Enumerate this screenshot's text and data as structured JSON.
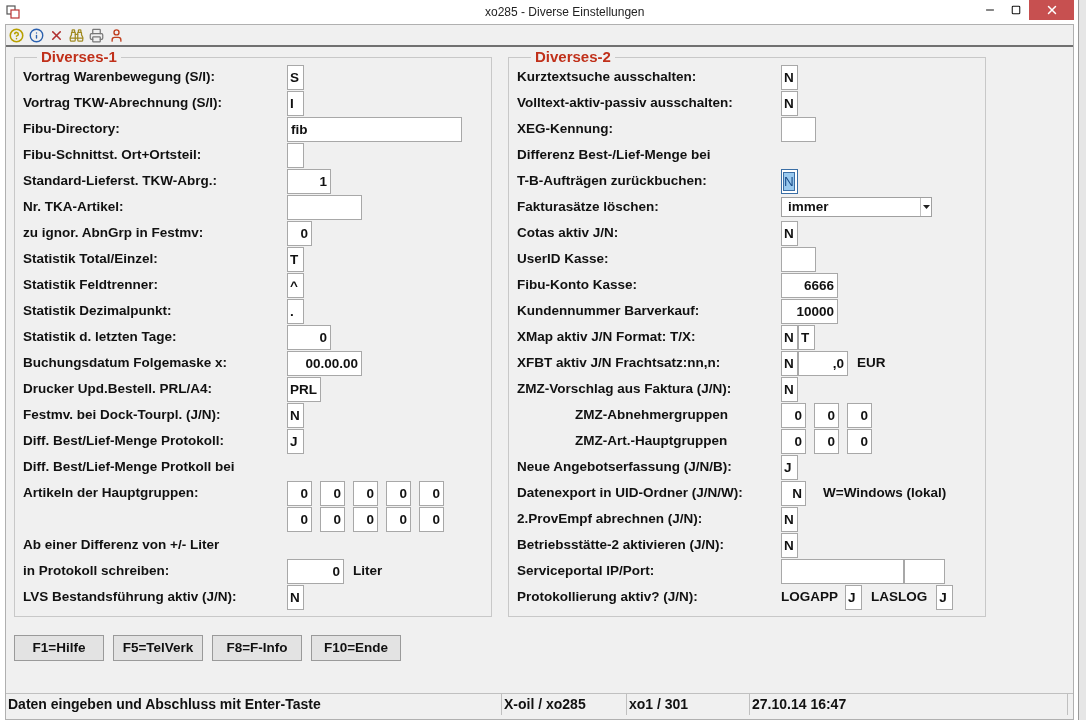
{
  "window": {
    "title": "xo285 - Diverse Einstellungen"
  },
  "panels": [
    {
      "title": "Diverses-1",
      "rows": [
        {
          "label": "Vortrag Warenbewegung  (S/I):",
          "items": [
            {
              "kind": "flag",
              "value": "S",
              "focused": false
            }
          ]
        },
        {
          "label": "Vortrag TKW-Abrechnung (S/I):",
          "items": [
            {
              "kind": "flag",
              "value": "I",
              "focused": false
            }
          ]
        },
        {
          "label": "Fibu-Directory:",
          "items": [
            {
              "kind": "long",
              "value": "fib",
              "focused": false
            }
          ]
        },
        {
          "label": "Fibu-Schnittst. Ort+Ortsteil:",
          "items": [
            {
              "kind": "flag",
              "focused": false
            }
          ]
        },
        {
          "label": "Standard-Lieferst. TKW-Abrg.:",
          "items": [
            {
              "kind": "number",
              "value": "1",
              "focused": false
            }
          ]
        },
        {
          "label": "Nr. TKA-Artikel:",
          "items": [
            {
              "kind": "wide",
              "focused": false
            }
          ]
        },
        {
          "label": "zu ignor. AbnGrp in Festmv:",
          "items": [
            {
              "kind": "digit",
              "value": "0",
              "focused": false
            }
          ]
        },
        {
          "label": "Statistik Total/Einzel:",
          "items": [
            {
              "kind": "flag",
              "value": "T",
              "focused": false
            }
          ]
        },
        {
          "label": "Statistik Feldtrenner:",
          "items": [
            {
              "kind": "flag",
              "value": "^",
              "focused": false
            }
          ]
        },
        {
          "label": "Statistik Dezimalpunkt:",
          "items": [
            {
              "kind": "flag",
              "value": ".",
              "focused": false
            }
          ]
        },
        {
          "label": "Statistik d. letzten Tage:",
          "items": [
            {
              "kind": "number",
              "value": "0",
              "focused": false
            }
          ]
        },
        {
          "label": "Buchungsdatum Folgemaske x:",
          "items": [
            {
              "kind": "wide",
              "value": "00.00.00",
              "focused": false
            }
          ]
        },
        {
          "label": "Drucker Upd.Bestell. PRL/A4:",
          "items": [
            {
              "kind": "short",
              "value": "PRL",
              "focused": false
            }
          ]
        },
        {
          "label": "Festmv. bei Dock-Tourpl. (J/N):",
          "items": [
            {
              "kind": "flag",
              "value": "N",
              "focused": false
            }
          ]
        },
        {
          "label": "Diff. Best/Lief-Menge Protokoll:",
          "items": [
            {
              "kind": "flag",
              "value": "J",
              "focused": false
            }
          ]
        },
        {
          "label": "Diff. Best/Lief-Menge Protkoll bei",
          "items": []
        },
        {
          "label": "Artikeln der Hauptgruppen:",
          "items": [
            {
              "kind": "digit",
              "value": "0",
              "focused": false
            },
            {
              "kind": "digit",
              "value": "0",
              "focused": false
            },
            {
              "kind": "digit",
              "value": "0",
              "focused": false
            },
            {
              "kind": "digit",
              "value": "0",
              "focused": false
            },
            {
              "kind": "digit",
              "value": "0",
              "focused": false
            }
          ]
        },
        {
          "items": [
            {
              "kind": "digit",
              "value": "0",
              "focused": false
            },
            {
              "kind": "digit",
              "value": "0",
              "focused": false
            },
            {
              "kind": "digit",
              "value": "0",
              "focused": false
            },
            {
              "kind": "digit",
              "value": "0",
              "focused": false
            },
            {
              "kind": "digit",
              "value": "0",
              "focused": false
            }
          ]
        },
        {
          "label": "Ab einer Differenz von +/- Liter",
          "items": []
        },
        {
          "label": "in Protokoll schreiben:",
          "items": [
            {
              "kind": "amount",
              "value": "0",
              "focused": false
            },
            {
              "kind": "text",
              "text": "Liter"
            }
          ]
        },
        {
          "label": "LVS Bestandsführung aktiv (J/N):",
          "items": [
            {
              "kind": "flag",
              "value": "N",
              "focused": false
            }
          ]
        }
      ]
    },
    {
      "title": "Diverses-2",
      "rows": [
        {
          "label": "Kurztextsuche ausschalten:",
          "indented": false,
          "items": [
            {
              "kind": "flag",
              "value": "N",
              "focused": false
            }
          ]
        },
        {
          "label": "Volltext-aktiv-passiv ausschalten:",
          "indented": false,
          "items": [
            {
              "kind": "flag",
              "value": "N",
              "focused": false
            }
          ]
        },
        {
          "label": "XEG-Kennung:",
          "indented": false,
          "items": [
            {
              "kind": "small",
              "focused": false
            }
          ]
        },
        {
          "label": "Differenz Best-/Lief-Menge bei",
          "indented": false,
          "items": []
        },
        {
          "label": "T-B-Aufträgen zurückbuchen:",
          "indented": false,
          "items": [
            {
              "kind": "flag",
              "value": "N",
              "focused": true
            }
          ]
        },
        {
          "label": "Fakturasätze löschen:",
          "indented": false,
          "items": [
            {
              "kind": "dropdown",
              "value": "immer"
            }
          ]
        },
        {
          "label": "Cotas aktiv J/N:",
          "indented": false,
          "items": [
            {
              "kind": "flag",
              "value": "N",
              "focused": false
            }
          ]
        },
        {
          "label": "UserID Kasse:",
          "indented": false,
          "items": [
            {
              "kind": "small",
              "focused": false
            }
          ]
        },
        {
          "label": "Fibu-Konto Kasse:",
          "indented": false,
          "items": [
            {
              "kind": "amount",
              "value": "6666",
              "focused": false
            }
          ]
        },
        {
          "label": "Kundennummer Barverkauf:",
          "indented": false,
          "items": [
            {
              "kind": "amount",
              "value": "10000",
              "focused": false
            }
          ]
        },
        {
          "label": "XMap aktiv J/N  Format: T/X:",
          "indented": false,
          "items": [
            {
              "kind": "flag",
              "value": "N",
              "focused": false
            },
            {
              "kind": "flag",
              "value": "T",
              "focused": false
            }
          ]
        },
        {
          "label": "XFBT aktiv J/N  Frachtsatz:nn,n:",
          "indented": false,
          "items": [
            {
              "kind": "flag",
              "value": "N",
              "focused": false
            },
            {
              "kind": "rate",
              "value": ",0",
              "focused": false
            },
            {
              "kind": "text",
              "text": "EUR"
            }
          ]
        },
        {
          "label": "ZMZ-Vorschlag aus Faktura (J/N):",
          "indented": false,
          "items": [
            {
              "kind": "flag",
              "value": "N",
              "focused": false
            }
          ]
        },
        {
          "label": "ZMZ-Abnehmergruppen",
          "indented": true,
          "items": [
            {
              "kind": "digit",
              "value": "0",
              "focused": false
            },
            {
              "kind": "digit",
              "value": "0",
              "focused": false
            },
            {
              "kind": "digit",
              "value": "0",
              "focused": false
            }
          ]
        },
        {
          "label": "ZMZ-Art.-Hauptgruppen",
          "indented": true,
          "items": [
            {
              "kind": "digit",
              "value": "0",
              "focused": false
            },
            {
              "kind": "digit",
              "value": "0",
              "focused": false
            },
            {
              "kind": "digit",
              "value": "0",
              "focused": false
            }
          ]
        },
        {
          "label": "Neue Angebotserfassung (J/N/B):",
          "indented": false,
          "items": [
            {
              "kind": "flag",
              "value": "J",
              "focused": false
            }
          ]
        },
        {
          "label": "Datenexport in UID-Ordner (J/N/W):",
          "indented": false,
          "items": [
            {
              "kind": "digit",
              "value": "N",
              "focused": false
            },
            {
              "kind": "text",
              "text": "W=Windows (lokal)"
            }
          ]
        },
        {
          "label": "2.ProvEmpf abrechnen (J/N):",
          "indented": false,
          "items": [
            {
              "kind": "flag",
              "value": "N",
              "focused": false
            }
          ]
        },
        {
          "label": "Betriebsstätte-2 aktivieren (J/N):",
          "indented": false,
          "items": [
            {
              "kind": "flag",
              "value": "N",
              "focused": false
            }
          ]
        },
        {
          "label": "Serviceportal IP/Port:",
          "indented": false,
          "items": [
            {
              "kind": "ip",
              "focused": false
            },
            {
              "kind": "port",
              "focused": false
            }
          ]
        },
        {
          "label": "Protokollierung aktiv? (J/N):",
          "indented": false,
          "items": [
            {
              "kind": "tag",
              "text": "LOGAPP"
            },
            {
              "kind": "flag",
              "value": "J",
              "focused": false
            },
            {
              "kind": "text",
              "text": "LASLOG"
            },
            {
              "kind": "flag",
              "value": "J",
              "focused": false
            }
          ]
        }
      ]
    }
  ],
  "buttons": [
    "F1=Hilfe",
    "F5=TelVerk",
    "F8=F-Info",
    "F10=Ende"
  ],
  "status_bar": [
    "Daten eingeben und Abschluss mit Enter-Taste",
    "X-oil / xo285",
    "xo1 / 301",
    "27.10.14 16:47"
  ]
}
